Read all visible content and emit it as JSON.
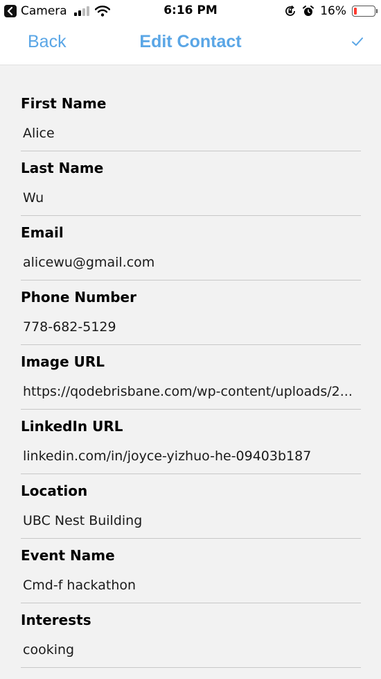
{
  "status_bar": {
    "back_app": "Camera",
    "time": "6:16 PM",
    "battery_percent": "16%",
    "battery_level": 0.16,
    "battery_color": "#ff3b30"
  },
  "nav": {
    "back_label": "Back",
    "title": "Edit Contact",
    "confirm_icon": "checkmark-icon",
    "accent_color": "#5aa6e6"
  },
  "fields": [
    {
      "label": "First Name",
      "value": "Alice"
    },
    {
      "label": "Last Name",
      "value": "Wu"
    },
    {
      "label": "Email",
      "value": "alicewu@gmail.com"
    },
    {
      "label": "Phone Number",
      "value": "778-682-5129"
    },
    {
      "label": "Image URL",
      "value": "https://qodebrisbane.com/wp-content/uploads/2..."
    },
    {
      "label": "LinkedIn URL",
      "value": "linkedin.com/in/joyce-yizhuo-he-09403b187"
    },
    {
      "label": "Location",
      "value": "UBC Nest Building"
    },
    {
      "label": "Event Name",
      "value": "Cmd-f hackathon"
    },
    {
      "label": "Interests",
      "value": "cooking"
    }
  ]
}
